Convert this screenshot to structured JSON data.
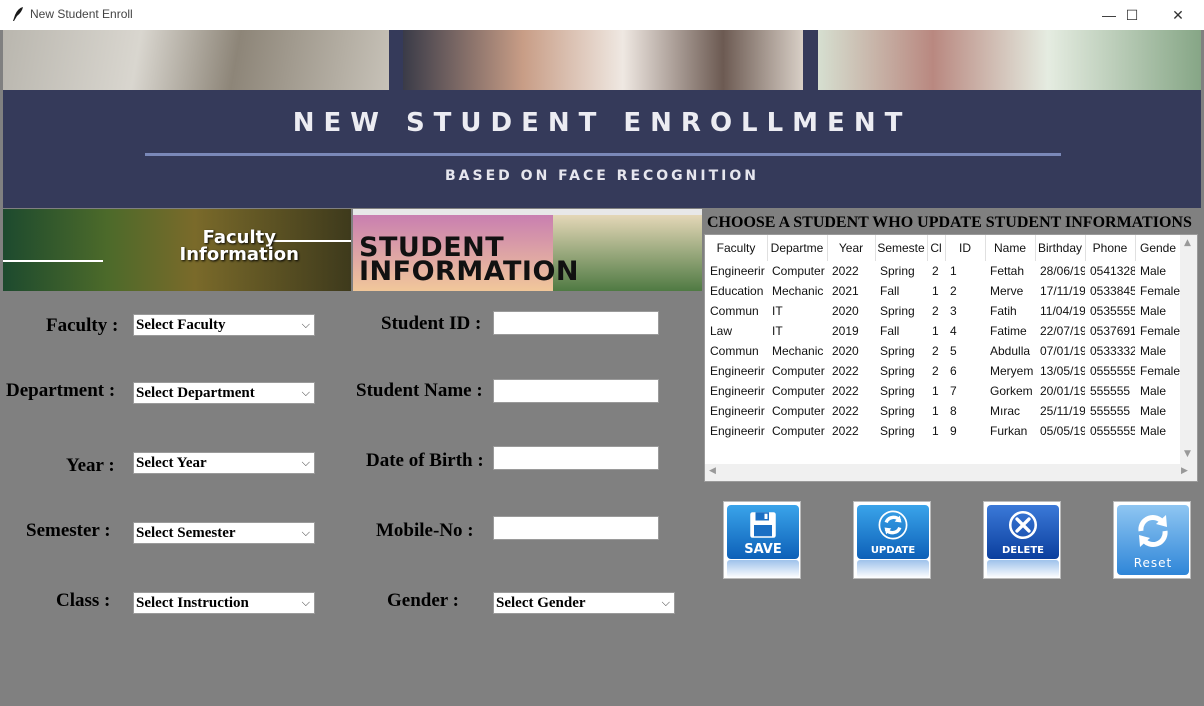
{
  "window": {
    "title": "New Student Enroll",
    "controls": {
      "minimize": "—",
      "maximize": "☐",
      "close": "✕"
    }
  },
  "banner": {
    "title": "NEW STUDENT ENROLLMENT",
    "subtitle": "BASED ON FACE RECOGNITION"
  },
  "faculty_banner": {
    "line1": "Faculty",
    "line2": "Information"
  },
  "student_banner": {
    "line1": "STUDENT",
    "line2": "INFORMATION"
  },
  "form": {
    "faculty_label": "Faculty :",
    "faculty_value": "Select Faculty",
    "department_label": "Department :",
    "department_value": "Select Department",
    "year_label": "Year :",
    "year_value": "Select Year",
    "semester_label": "Semester :",
    "semester_value": "Select Semester",
    "class_label": "Class :",
    "class_value": "Select Instruction",
    "student_id_label": "Student ID :",
    "student_id_value": "",
    "student_name_label": "Student Name :",
    "student_name_value": "",
    "dob_label": "Date of Birth :",
    "dob_value": "",
    "mobile_label": "Mobile-No :",
    "mobile_value": "",
    "gender_label": "Gender :",
    "gender_value": "Select Gender"
  },
  "table": {
    "title": "CHOOSE A STUDENT WHO UPDATE STUDENT INFORMATIONS",
    "columns": [
      "Faculty",
      "Departme",
      "Year",
      "Semeste",
      "Cl",
      "ID",
      "Name",
      "Birthday",
      "Phone",
      "Gende"
    ],
    "rows": [
      [
        "Engineerir",
        "Computer",
        "2022",
        "Spring",
        "2",
        "1",
        "Fettah",
        "28/06/19",
        "0541328",
        "Male"
      ],
      [
        "Education",
        "Mechanic",
        "2021",
        "Fall",
        "1",
        "2",
        "Merve",
        "17/11/19",
        "0533845",
        "Female"
      ],
      [
        "Commun",
        "IT",
        "2020",
        "Spring",
        "2",
        "3",
        "Fatih",
        "11/04/19",
        "0535555",
        "Male"
      ],
      [
        "Law",
        "IT",
        "2019",
        "Fall",
        "1",
        "4",
        "Fatime",
        "22/07/19",
        "0537691",
        "Female"
      ],
      [
        "Commun",
        "Mechanic",
        "2020",
        "Spring",
        "2",
        "5",
        "Abdulla",
        "07/01/19",
        "0533332",
        "Male"
      ],
      [
        "Engineerir",
        "Computer",
        "2022",
        "Spring",
        "2",
        "6",
        "Meryem",
        "13/05/19",
        "0555555",
        "Female"
      ],
      [
        "Engineerir",
        "Computer",
        "2022",
        "Spring",
        "1",
        "7",
        "Gorkem",
        "20/01/19",
        "555555",
        "Male"
      ],
      [
        "Engineerir",
        "Computer",
        "2022",
        "Spring",
        "1",
        "8",
        "Mırac",
        "25/11/19",
        "555555",
        "Male"
      ],
      [
        "Engineerir",
        "Computer",
        "2022",
        "Spring",
        "1",
        "9",
        "Furkan",
        "05/05/19",
        "0555555",
        "Male"
      ]
    ]
  },
  "actions": {
    "save": "SAVE",
    "update": "UPDATE",
    "delete": "DELETE",
    "reset": "Reset"
  },
  "icons": {
    "chevron": "⌵",
    "scroll_up": "▲",
    "scroll_down": "▼",
    "scroll_left": "◀",
    "scroll_right": "▶",
    "close_x": "✕",
    "refresh": "⟳"
  },
  "colors": {
    "background": "#808080",
    "banner": "#353a5a",
    "button_blue": "#0d60b8"
  }
}
